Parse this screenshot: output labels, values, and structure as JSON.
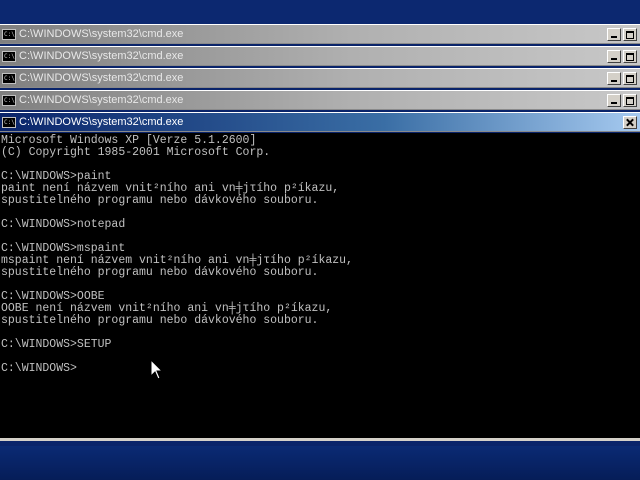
{
  "windows": [
    {
      "title": "C:\\WINDOWS\\system32\\cmd.exe",
      "state": "inactive"
    },
    {
      "title": "C:\\WINDOWS\\system32\\cmd.exe",
      "state": "inactive"
    },
    {
      "title": "C:\\WINDOWS\\system32\\cmd.exe",
      "state": "inactive"
    },
    {
      "title": "C:\\WINDOWS\\system32\\cmd.exe",
      "state": "inactive"
    },
    {
      "title": "C:\\WINDOWS\\system32\\cmd.exe",
      "state": "active"
    }
  ],
  "app_icon_text": "C:\\",
  "console": {
    "lines": [
      "Microsoft Windows XP [Verze 5.1.2600]",
      "(C) Copyright 1985-2001 Microsoft Corp.",
      "",
      "C:\\WINDOWS>paint",
      "paint není názvem vnit²ního ani vn╪jτího p²íkazu,",
      "spustitelného programu nebo dávkového souboru.",
      "",
      "C:\\WINDOWS>notepad",
      "",
      "C:\\WINDOWS>mspaint",
      "mspaint není názvem vnit²ního ani vn╪jτího p²íkazu,",
      "spustitelného programu nebo dávkového souboru.",
      "",
      "C:\\WINDOWS>OOBE",
      "OOBE není názvem vnit²ního ani vn╪jτího p²íkazu,",
      "spustitelného programu nebo dávkového souboru.",
      "",
      "C:\\WINDOWS>SETUP",
      "",
      "C:\\WINDOWS>"
    ]
  },
  "colors": {
    "desktop": "#0a246a",
    "console_bg": "#000000",
    "console_fg": "#c0c0c0",
    "active_title": "#0a246a",
    "inactive_title": "#808080"
  },
  "icons": [
    "cmd-icon",
    "minimize-icon",
    "maximize-icon",
    "close-icon",
    "mouse-pointer-icon"
  ]
}
